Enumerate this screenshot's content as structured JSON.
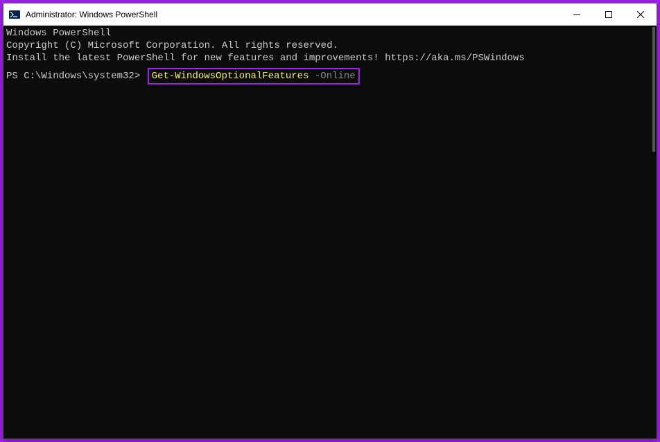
{
  "window": {
    "title": "Administrator: Windows PowerShell"
  },
  "terminal": {
    "line1": "Windows PowerShell",
    "line2": "Copyright (C) Microsoft Corporation. All rights reserved.",
    "line3": "",
    "line4": "Install the latest PowerShell for new features and improvements! https://aka.ms/PSWindows",
    "line5": "",
    "prompt": "PS C:\\Windows\\system32> ",
    "cmdlet": "Get-WindowsOptionalFeatures",
    "param": " -Online"
  }
}
